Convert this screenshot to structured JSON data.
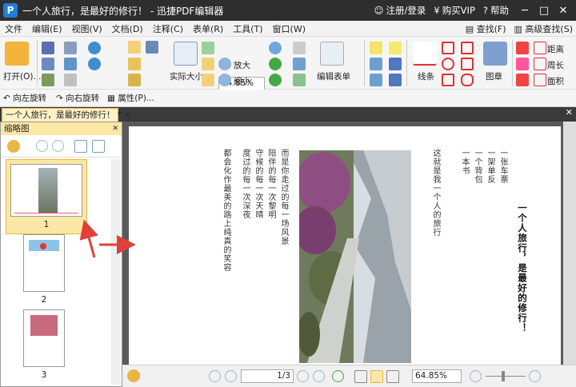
{
  "titlebar": {
    "title": "一个人旅行，是最好的修行！ - 迅捷PDF编辑器",
    "register": "注册/登录",
    "buy": "购买VIP",
    "help": "帮助"
  },
  "menu": {
    "items": [
      "文件",
      "编辑(E)",
      "视图(V)",
      "文档(D)",
      "注释(C)",
      "表单(R)",
      "工具(T)",
      "窗口(W)"
    ],
    "find": "查找(F)",
    "advanced_find": "高级查找(S)"
  },
  "ribbon": {
    "open_label": "打开(O)...",
    "actual_size": "实际大小",
    "zoom_value": "64.85%",
    "zoom_in": "放大",
    "zoom_out": "缩小",
    "edit_form": "编辑表单",
    "line": "线条",
    "shape": "图章",
    "distance": "距离",
    "perimeter": "周长",
    "area": "面积"
  },
  "toolbar2": {
    "rotate_left": "向左旋转",
    "rotate_right": "向右旋转",
    "properties": "属性(P)..."
  },
  "tab": {
    "label": "一个人旅行，是最好的修行！ *"
  },
  "thumbnails": {
    "title": "缩略图",
    "pages": [
      "1",
      "2",
      "3"
    ]
  },
  "document": {
    "heading": "一个人旅行，是最好的修行！",
    "col1": [
      "一张车票",
      "一架单反",
      "一个背包",
      "一本书",
      "这就是我一个人的旅行"
    ],
    "col2": [
      "而是你走过的每一场风景",
      "陪伴的每一次黎明",
      "守候的每一次天晴",
      "度过的每一次深夜",
      "都会化作最美的路上纯真的笑容"
    ]
  },
  "status": {
    "page": "1",
    "total": "/3",
    "zoom": "64.85%"
  },
  "colors": {
    "accent": "#e8b84a",
    "arrow": "#e0403a",
    "titlebar": "#2e2e2e"
  }
}
